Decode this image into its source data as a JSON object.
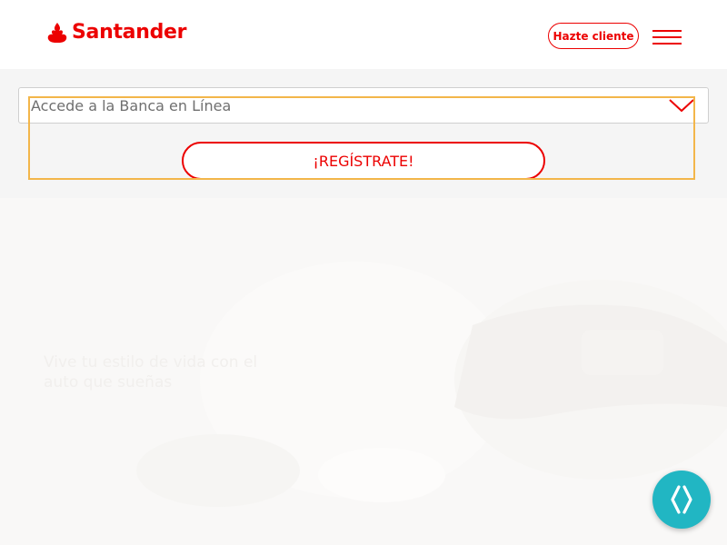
{
  "header": {
    "brand": "Santander",
    "cta_label": "Hazte cliente",
    "menu_icon": "hamburger-menu-icon"
  },
  "access": {
    "select_label": "Accede a la Banca en Línea",
    "register_label": "¡REGÍSTRATE!"
  },
  "hero": {
    "tagline": "Vive tu estilo de vida con el auto que sueñas"
  },
  "chat": {
    "icon": "chat-assistant-icon"
  },
  "colors": {
    "brand_red": "#ec0000",
    "focus_outline": "#f3b64a",
    "chat_teal": "#21b6c3",
    "panel_gray": "#f5f5f5"
  }
}
